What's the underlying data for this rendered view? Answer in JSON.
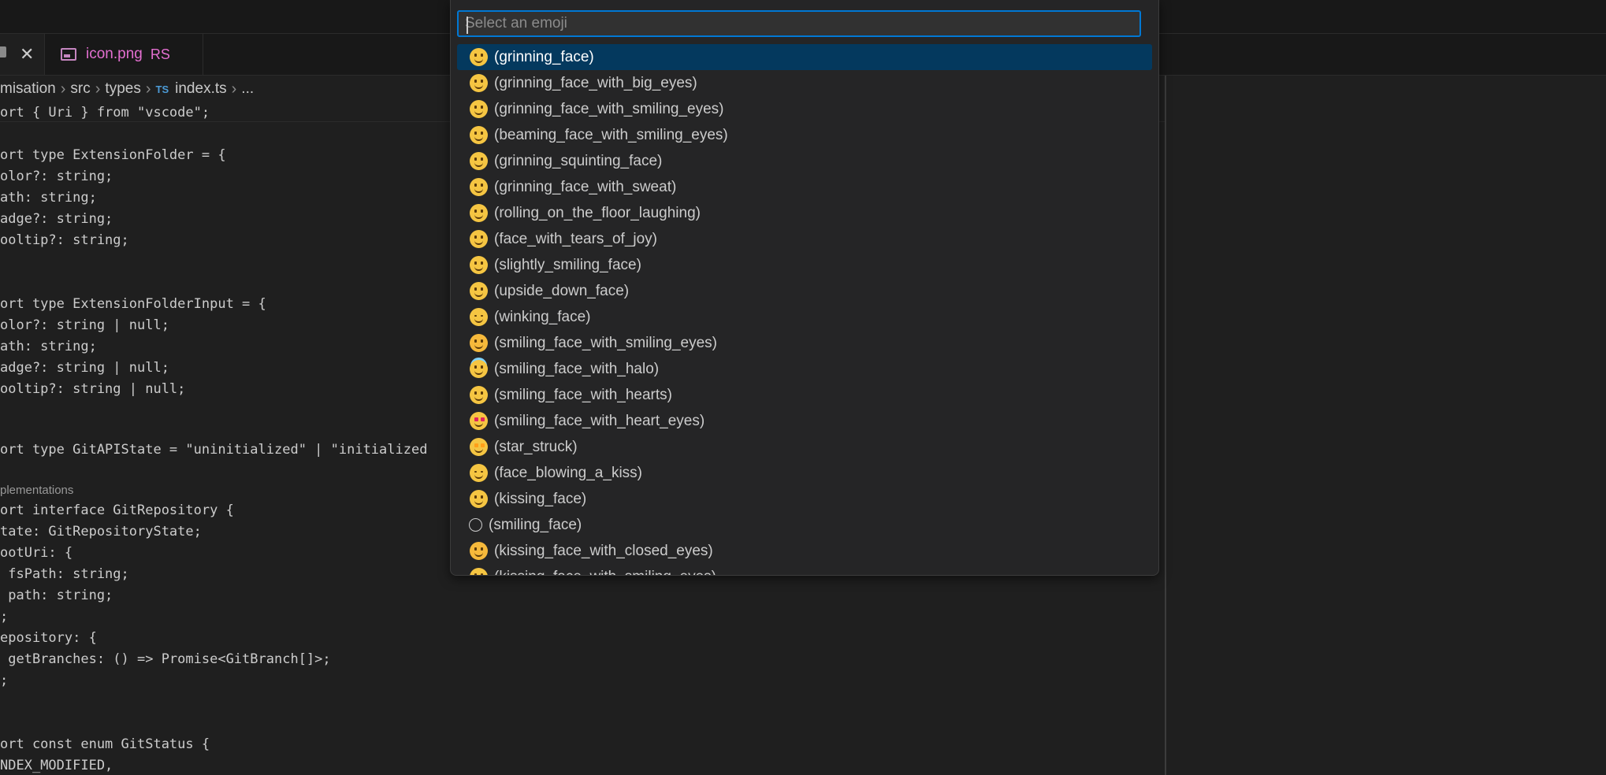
{
  "tabs": [
    {
      "label": "",
      "close": "✕",
      "active": true
    },
    {
      "label": "icon.png",
      "badge": "RS",
      "active": false
    }
  ],
  "breadcrumb": {
    "items": [
      "misation",
      "src",
      "types",
      "index.ts",
      "..."
    ],
    "sep": "›",
    "file_badge": "TS"
  },
  "editor": {
    "codelens": "plementations",
    "lines": [
      "ort { Uri } from \"vscode\";",
      "",
      "ort type ExtensionFolder = {",
      "olor?: string;",
      "ath: string;",
      "adge?: string;",
      "ooltip?: string;",
      "",
      "",
      "ort type ExtensionFolderInput = {",
      "olor?: string | null;",
      "ath: string;",
      "adge?: string | null;",
      "ooltip?: string | null;",
      "",
      "",
      "ort type GitAPIState = \"uninitialized\" | \"initialized",
      "ort interface GitRepository {",
      "tate: GitRepositoryState;",
      "ootUri: {",
      " fsPath: string;",
      " path: string;",
      ";",
      "epository: {",
      " getBranches: () => Promise<GitBranch[]>;",
      ";",
      "",
      "",
      "ort const enum GitStatus {",
      "NDEX_MODIFIED,"
    ]
  },
  "picker": {
    "placeholder": "Select an emoji",
    "items": [
      {
        "label": "(grinning_face)",
        "icon": "grinning-face-icon",
        "selected": true
      },
      {
        "label": "(grinning_face_with_big_eyes)",
        "icon": "grinning-face-with-big-eyes-icon"
      },
      {
        "label": "(grinning_face_with_smiling_eyes)",
        "icon": "grinning-face-with-smiling-eyes-icon"
      },
      {
        "label": "(beaming_face_with_smiling_eyes)",
        "icon": "beaming-face-icon"
      },
      {
        "label": "(grinning_squinting_face)",
        "icon": "grinning-squinting-face-icon"
      },
      {
        "label": "(grinning_face_with_sweat)",
        "icon": "grinning-face-with-sweat-icon"
      },
      {
        "label": "(rolling_on_the_floor_laughing)",
        "icon": "rolling-on-floor-laughing-icon"
      },
      {
        "label": "(face_with_tears_of_joy)",
        "icon": "face-with-tears-of-joy-icon"
      },
      {
        "label": "(slightly_smiling_face)",
        "icon": "slightly-smiling-face-icon"
      },
      {
        "label": "(upside_down_face)",
        "icon": "upside-down-face-icon"
      },
      {
        "label": "(winking_face)",
        "icon": "winking-face-icon"
      },
      {
        "label": "(smiling_face_with_smiling_eyes)",
        "icon": "smiling-face-with-smiling-eyes-icon"
      },
      {
        "label": "(smiling_face_with_halo)",
        "icon": "smiling-face-with-halo-icon"
      },
      {
        "label": "(smiling_face_with_hearts)",
        "icon": "smiling-face-with-hearts-icon"
      },
      {
        "label": "(smiling_face_with_heart_eyes)",
        "icon": "smiling-face-with-heart-eyes-icon"
      },
      {
        "label": "(star_struck)",
        "icon": "star-struck-icon"
      },
      {
        "label": "(face_blowing_a_kiss)",
        "icon": "face-blowing-a-kiss-icon"
      },
      {
        "label": "(kissing_face)",
        "icon": "kissing-face-icon"
      },
      {
        "label": "(smiling_face)",
        "icon": "smiling-face-icon"
      },
      {
        "label": "(kissing_face_with_closed_eyes)",
        "icon": "kissing-face-with-closed-eyes-icon"
      },
      {
        "label": "(kissing_face_with_smiling_eyes)",
        "icon": "kissing-face-with-smiling-eyes-icon"
      }
    ]
  },
  "colors": {
    "accent": "#0078d4",
    "selection": "#04395e",
    "editor_bg": "#1f1f1f"
  }
}
